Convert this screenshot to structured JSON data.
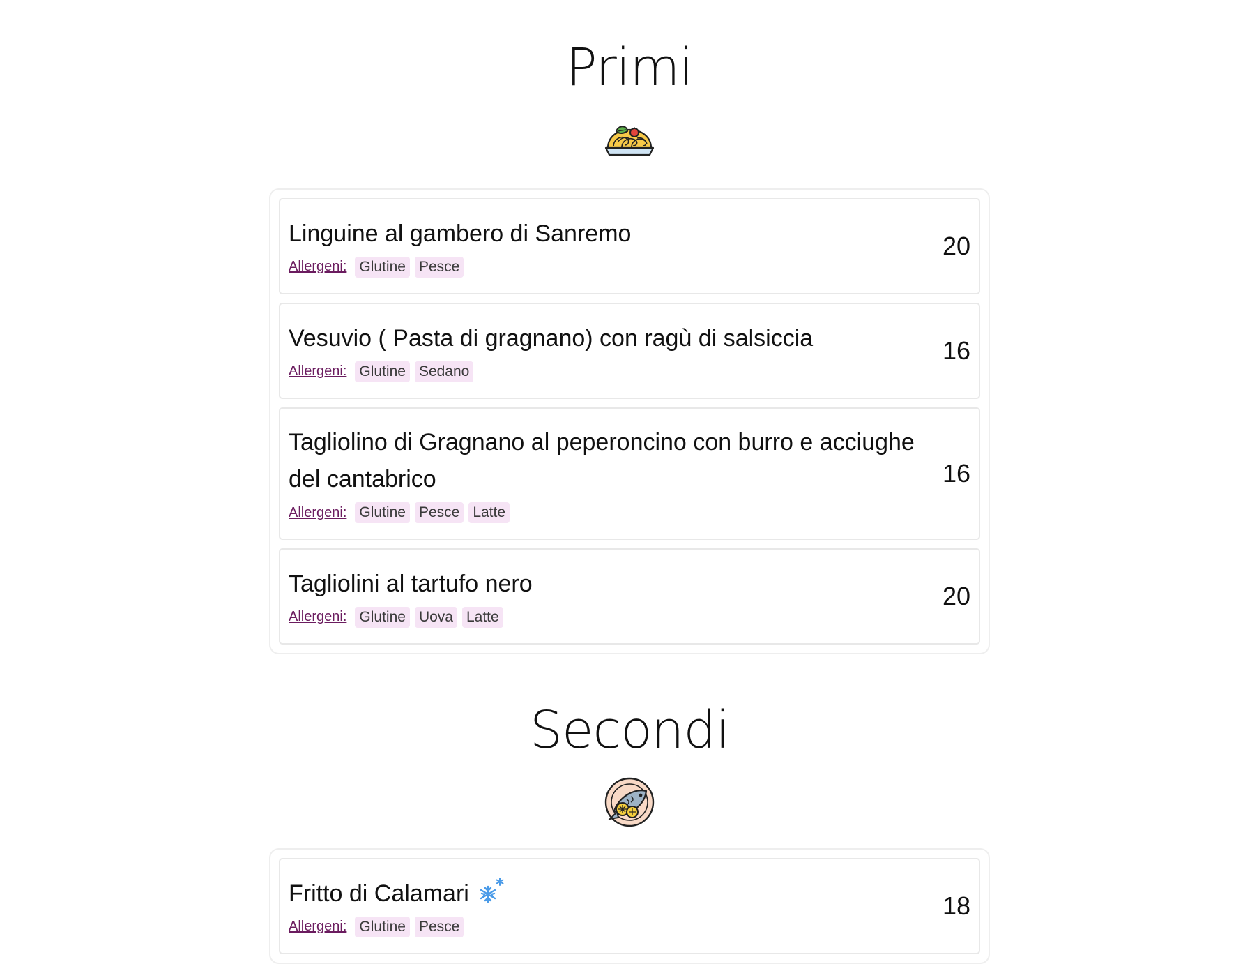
{
  "sections": [
    {
      "title": "Primi",
      "icon": "pasta-plate-icon",
      "items": [
        {
          "name": "Linguine al gambero di Sanremo",
          "price": "20",
          "allergens_label": "Allergeni:",
          "allergens": [
            "Glutine",
            "Pesce"
          ]
        },
        {
          "name": "Vesuvio ( Pasta di gragnano) con ragù di salsiccia",
          "price": "16",
          "allergens_label": "Allergeni:",
          "allergens": [
            "Glutine",
            "Sedano"
          ]
        },
        {
          "name": "Tagliolino di Gragnano al peperoncino con burro e acciughe del cantabrico",
          "price": "16",
          "allergens_label": "Allergeni:",
          "allergens": [
            "Glutine",
            "Pesce",
            "Latte"
          ]
        },
        {
          "name": "Tagliolini al tartufo nero",
          "price": "20",
          "allergens_label": "Allergeni:",
          "allergens": [
            "Glutine",
            "Uova",
            "Latte"
          ]
        }
      ]
    },
    {
      "title": "Secondi",
      "icon": "fish-plate-icon",
      "items": [
        {
          "name": "Fritto di Calamari",
          "frozen_icon": "snowflake-icon",
          "price": "18",
          "allergens_label": "Allergeni:",
          "allergens": [
            "Glutine",
            "Pesce"
          ]
        }
      ]
    }
  ],
  "colors": {
    "allergen_link": "#6b1c5f",
    "allergen_tag_bg": "#f6e4f5",
    "snowflake": "#4a9be8"
  }
}
